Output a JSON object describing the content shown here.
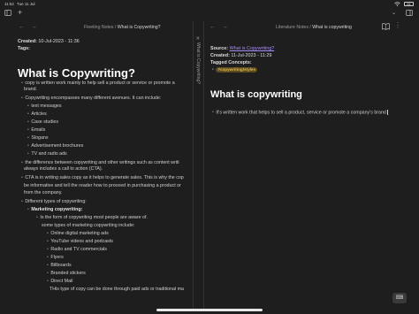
{
  "status_bar": {
    "time": "11:52",
    "date": "Tue 11 Jul",
    "battery": "84"
  },
  "icons": {
    "sidebar_toggle": "sidebar-icon",
    "new_tab": "plus-icon",
    "chevron": "chevron-down-icon",
    "sidebar_right": "sidebar-right-icon",
    "back": "arrow-left-icon",
    "forward": "arrow-right-icon",
    "reading": "book-icon",
    "more": "more-icon",
    "close": "close-icon"
  },
  "colors": {
    "background": "#1e1e1e",
    "link": "#a78bfa",
    "tag_text": "#e0b84a",
    "tag_bg": "#5a4a1f"
  },
  "side_strip": {
    "label": "What is Copywriting?"
  },
  "left_pane": {
    "breadcrumb_folder": "Fleeting Notes",
    "breadcrumb_sep": " / ",
    "breadcrumb_note": "What is Copywriting?",
    "created_label": "Created:",
    "created_value": "10-Jul-2023 - 11:36",
    "tags_label": "Tags:",
    "heading": "What is Copywriting?",
    "lines": {
      "l1": "copy is written work mainly to help sell a product or service or promote a",
      "l1b": "brand.",
      "l2": "Copywriting encompasses many different avenues. It can include:",
      "l3": "text messages",
      "l4": "Articles",
      "l5": "Case studies",
      "l6": "Emails",
      "l7": "Slogans",
      "l8": "Advertisement brochures",
      "l9": "TV and radio ads",
      "l10": "the difference between copywriting and other writings such as content writi",
      "l10b": "always includes a call to action (CTA).",
      "l11": "CTA is in writing sales copy as it helps to generate sales. This is why the cop",
      "l11b": "be informative and tell the reader how to proceed in purchasing a product or",
      "l11c": "from the company.",
      "l12": "Different types of copywriting:",
      "l13": "Marketing copywriting:",
      "l14": "Is the form of copywriting most people are aware of.",
      "l15": "some types of marketing copywriting include:",
      "l16": "Online digital marketing ads",
      "l17": "YouTube videos and podcasts",
      "l18": "Radio and TV commercials",
      "l19": "Flyers",
      "l20": "Billboards",
      "l21": "Branded stickers",
      "l22": "Direct Mail",
      "l23": "THis type of copy can be done through paid ads or traditional ma"
    }
  },
  "right_pane": {
    "breadcrumb_folder": "Literature Notes",
    "breadcrumb_sep": " / ",
    "breadcrumb_note": "What is copywriting",
    "source_label": "Source:",
    "source_link": "What is Copywriting?",
    "created_label": "Created:",
    "created_value": "11-Jul-2023 - 11:29",
    "tagged_label": "Tagged Concepts:",
    "tag": "#copywriting/styles",
    "heading": "What is copywriting",
    "body": "It's written work that helps to sell a product, service or promote a  company's brand"
  },
  "keyboard_button": "⌨"
}
